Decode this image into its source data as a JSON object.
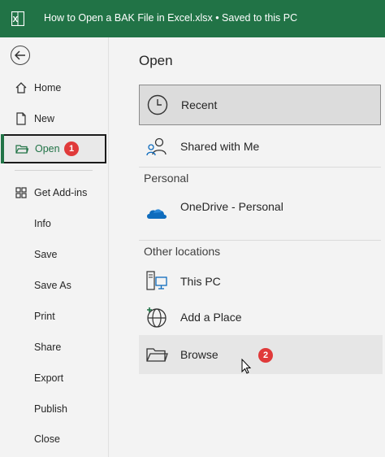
{
  "titlebar": {
    "title": "How to Open a BAK File in Excel.xlsx  •  Saved to this PC",
    "app_icon": "excel-icon"
  },
  "sidebar": {
    "back_icon": "back-arrow-icon",
    "items": [
      {
        "label": "Home",
        "icon": "home-icon"
      },
      {
        "label": "New",
        "icon": "new-document-icon"
      },
      {
        "label": "Open",
        "icon": "open-folder-icon",
        "selected": true
      },
      {
        "label": "Get Add-ins",
        "icon": "add-ins-icon"
      },
      {
        "label": "Info"
      },
      {
        "label": "Save"
      },
      {
        "label": "Save As"
      },
      {
        "label": "Print"
      },
      {
        "label": "Share"
      },
      {
        "label": "Export"
      },
      {
        "label": "Publish"
      },
      {
        "label": "Close"
      }
    ]
  },
  "main": {
    "title": "Open",
    "recent_label": "Recent",
    "shared_label": "Shared with Me",
    "personal_heading": "Personal",
    "onedrive_label": "OneDrive - Personal",
    "onedrive_sub": "",
    "other_heading": "Other locations",
    "this_pc_label": "This PC",
    "add_place_label": "Add a Place",
    "browse_label": "Browse"
  },
  "annotations": {
    "step1": "1",
    "step2": "2"
  },
  "colors": {
    "excel_green": "#217346",
    "badge_red": "#e03a3a",
    "onedrive_blue": "#0f6cbd"
  }
}
